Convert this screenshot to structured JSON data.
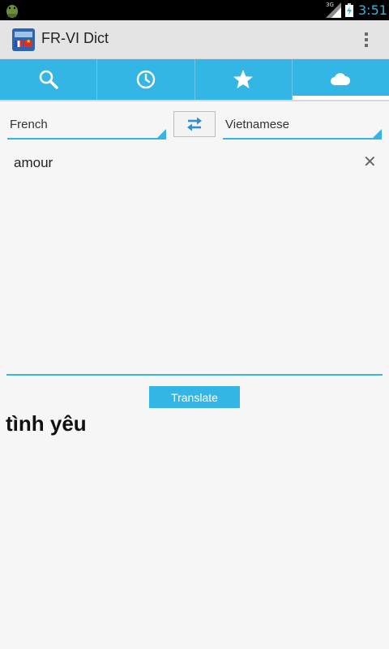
{
  "status_bar": {
    "network_label": "3G",
    "time": "3:51",
    "icons": [
      "android-icon",
      "signal-icon",
      "battery-icon"
    ]
  },
  "action_bar": {
    "title": "FR-VI Dict",
    "icons": [
      "app-logo-icon",
      "overflow-menu-icon"
    ]
  },
  "tabs": [
    {
      "icon": "search-icon",
      "active": false
    },
    {
      "icon": "history-clock-icon",
      "active": false
    },
    {
      "icon": "favorite-star-icon",
      "active": false
    },
    {
      "icon": "cloud-icon",
      "active": true
    }
  ],
  "languages": {
    "source": "French",
    "target": "Vietnamese",
    "swap_icon": "swap-arrows-icon"
  },
  "input": {
    "value": "amour",
    "clear_icon": "close-icon"
  },
  "translate_label": "Translate",
  "result": "tình yêu",
  "colors": {
    "accent": "#33b5e5",
    "background": "#f6f6f6",
    "action_bar": "#e4e4e4",
    "status_bar": "#000000"
  }
}
